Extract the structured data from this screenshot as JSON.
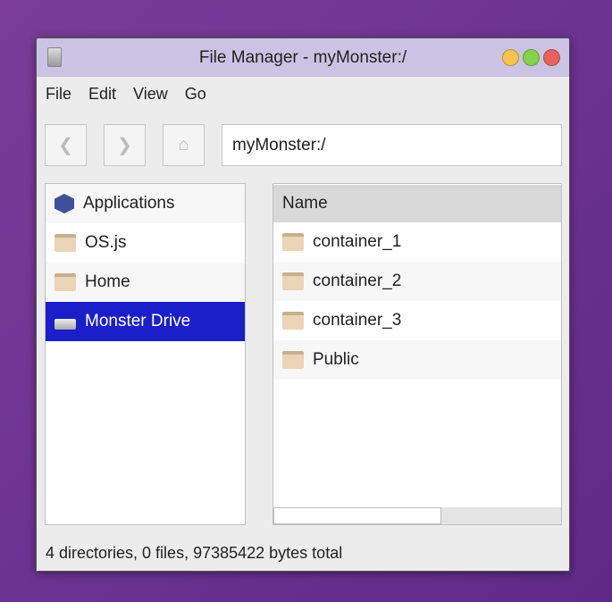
{
  "window": {
    "title": "File Manager - myMonster:/",
    "controls": {
      "minimize": "#f7c34f",
      "maximize": "#86d24a",
      "close": "#e8635b"
    }
  },
  "menu": [
    "File",
    "Edit",
    "View",
    "Go"
  ],
  "toolbar": {
    "back": "back-icon",
    "forward": "forward-icon",
    "home": "home-icon",
    "address": "myMonster:/"
  },
  "sidebar": [
    {
      "label": "Applications",
      "icon": "applications-icon"
    },
    {
      "label": "OS.js",
      "icon": "folder-icon"
    },
    {
      "label": "Home",
      "icon": "home-folder-icon"
    },
    {
      "label": "Monster Drive",
      "icon": "drive-icon",
      "selected": true
    }
  ],
  "files": {
    "header": "Name",
    "items": [
      "container_1",
      "container_2",
      "container_3",
      "Public"
    ]
  },
  "status": "4 directories, 0 files, 97385422 bytes total"
}
